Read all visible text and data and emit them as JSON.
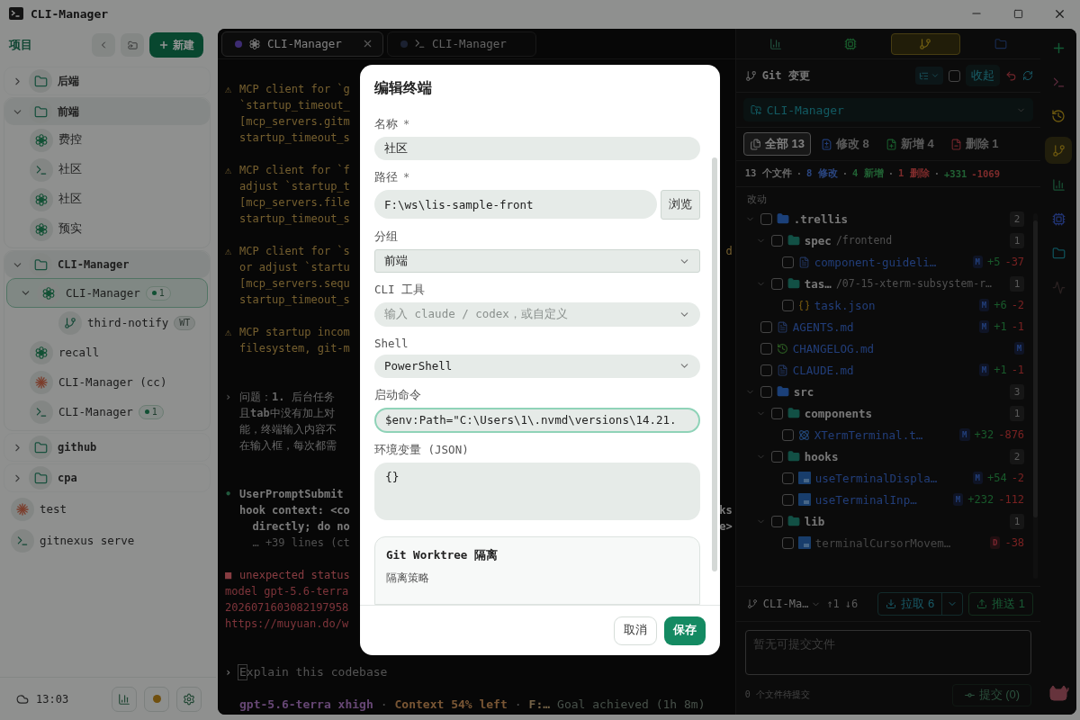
{
  "window": {
    "title": "CLI-Manager"
  },
  "sidebar": {
    "title": "项目",
    "new_button": "新建",
    "clock": "13:03",
    "items": [
      {
        "kind": "group",
        "label": "后端",
        "expanded": false,
        "selected": false
      },
      {
        "kind": "group",
        "label": "前端",
        "expanded": true,
        "selected": false,
        "children": [
          {
            "kind": "codex",
            "label": "费控",
            "selected": false
          },
          {
            "kind": "shell",
            "label": "社区",
            "selected": false
          },
          {
            "kind": "codex",
            "label": "社区",
            "selected": false
          },
          {
            "kind": "codex",
            "label": "预实",
            "selected": false
          }
        ]
      },
      {
        "kind": "group",
        "label": "CLI-Manager",
        "expanded": true,
        "selected": false,
        "children": [
          {
            "kind": "codex",
            "label": "CLI-Manager",
            "selected": true,
            "expanded": true,
            "badge": "1",
            "children": [
              {
                "kind": "worktree",
                "label": "third-notify",
                "selected": false,
                "tag": "WT"
              }
            ]
          },
          {
            "kind": "codex",
            "label": "recall",
            "selected": false
          },
          {
            "kind": "claude",
            "label": "CLI-Manager (cc)",
            "selected": false
          },
          {
            "kind": "shell",
            "label": "CLI-Manager",
            "selected": false,
            "badge": "1"
          }
        ]
      },
      {
        "kind": "group",
        "label": "github",
        "expanded": false,
        "selected": false
      },
      {
        "kind": "group",
        "label": "cpa",
        "expanded": false,
        "selected": false
      },
      {
        "kind": "claude",
        "label": "test",
        "selected": false
      },
      {
        "kind": "shell",
        "label": "gitnexus serve",
        "selected": false
      }
    ]
  },
  "terminal": {
    "tabs": [
      {
        "kind": "codex",
        "label": "CLI-Manager",
        "selected": true,
        "closable": true
      },
      {
        "kind": "shell",
        "label": "CLI-Manager",
        "selected": false,
        "closable": false
      }
    ],
    "blocks": [
      {
        "kind": "warning",
        "marker": "⚠",
        "lines": [
          {
            "text": "MCP client for `g"
          },
          {
            "text": "`startup_timeout_"
          },
          {
            "text": "[mcp_servers.gitm"
          },
          {
            "text": "startup_timeout_s"
          }
        ]
      },
      {
        "kind": "warning",
        "marker": "⚠",
        "lines": [
          {
            "text": "MCP client for `f"
          },
          {
            "text": "adjust `startup_t"
          },
          {
            "text": "[mcp_servers.file"
          },
          {
            "text": "startup_timeout_s"
          }
        ]
      },
      {
        "kind": "warning",
        "marker": "⚠",
        "lines": [
          {
            "text": "MCP client for `s",
            "tail": "d"
          },
          {
            "text": "or adjust `startu"
          },
          {
            "text": "[mcp_servers.sequ"
          },
          {
            "text": "startup_timeout_s"
          }
        ]
      },
      {
        "kind": "warning",
        "marker": "⚠",
        "lines": [
          {
            "text": "MCP startup incom"
          },
          {
            "text": "filesystem, git-m"
          }
        ]
      },
      {
        "kind": "user",
        "marker": "›",
        "lines": [
          {
            "text": "问题：**1.** 后台任务"
          },
          {
            "text": "且**tab**中没有加上对"
          },
          {
            "text": "能，终端输入内容不"
          },
          {
            "text": "在输入框，每次都需"
          }
        ]
      },
      {
        "kind": "hook",
        "marker": "•",
        "lines": [
          {
            "text": "UserPromptSubmit",
            "muted": false
          },
          {
            "text": "hook context: <co",
            "tail": "ks",
            "muted": false
          },
          {
            "text": "  directly; do no",
            "tail": "e>",
            "muted": false
          },
          {
            "text": "  … +39 lines (ct",
            "muted": true
          }
        ]
      },
      {
        "kind": "error",
        "marker": "■",
        "lines": [
          {
            "text": "unexpected status"
          },
          {
            "text": "model gpt-5.6-terra"
          },
          {
            "text": "2026071603082197958"
          },
          {
            "text": "https://muyuan.do/w"
          }
        ]
      }
    ],
    "prompt": {
      "marker": "›",
      "placeholder": "Explain this codebase"
    },
    "status": [
      {
        "kind": "model",
        "text": "gpt-5.6-terra xhigh"
      },
      {
        "kind": "sep",
        "text": "·"
      },
      {
        "kind": "context",
        "text": "Context 54% left"
      },
      {
        "kind": "sep",
        "text": "·"
      },
      {
        "kind": "path",
        "text": "F:…"
      },
      {
        "kind": "goal",
        "text": "Goal achieved (1h 8m)"
      }
    ]
  },
  "git": {
    "tabs": [
      {
        "kind": "stats",
        "selected": false
      },
      {
        "kind": "chip",
        "selected": false
      },
      {
        "kind": "branch",
        "selected": true
      },
      {
        "kind": "folder",
        "selected": false
      }
    ],
    "title": "Git 变更",
    "select_all": false,
    "collapse_button": "收起",
    "repo": "CLI-Manager",
    "filters": [
      {
        "kind": "all",
        "label": "全部",
        "count": "13",
        "selected": true
      },
      {
        "kind": "modified",
        "label": "修改",
        "count": "8",
        "selected": false
      },
      {
        "kind": "added",
        "label": "新增",
        "count": "4",
        "selected": false
      },
      {
        "kind": "deleted",
        "label": "删除",
        "count": "1",
        "selected": false
      }
    ],
    "summary": [
      {
        "kind": "total",
        "text": "13 个文件"
      },
      {
        "kind": "sep",
        "text": "·"
      },
      {
        "kind": "modified",
        "text": "8 修改"
      },
      {
        "kind": "sep",
        "text": "·"
      },
      {
        "kind": "added",
        "text": "4 新增"
      },
      {
        "kind": "sep",
        "text": "·"
      },
      {
        "kind": "deleted",
        "text": "1 删除"
      },
      {
        "kind": "sep",
        "text": "·"
      },
      {
        "kind": "added",
        "text": "+331"
      },
      {
        "kind": "deleted",
        "text": "-1069"
      }
    ],
    "section": "改动",
    "tree": [
      {
        "kind": "folder",
        "name": ".trellis",
        "count": "2",
        "checked": false,
        "expanded": true,
        "children": [
          {
            "kind": "folder",
            "name": "spec",
            "path": "/frontend",
            "count": "1",
            "checked": false,
            "expanded": true,
            "children": [
              {
                "kind": "markdown",
                "name": "component-guideli…",
                "status": "M",
                "deleted": false,
                "added": "+5",
                "removed": "-37",
                "checked": false
              }
            ]
          },
          {
            "kind": "folder",
            "name": "tas…",
            "path": "/07-15-xterm-subsystem-r…",
            "count": "1",
            "checked": false,
            "expanded": true,
            "children": [
              {
                "kind": "json",
                "name": "task.json",
                "status": "M",
                "deleted": false,
                "added": "+6",
                "removed": "-2",
                "checked": false
              }
            ]
          }
        ]
      },
      {
        "kind": "markdown",
        "name": "AGENTS.md",
        "status": "M",
        "deleted": false,
        "added": "+1",
        "removed": "-1",
        "checked": false
      },
      {
        "kind": "changelog",
        "name": "CHANGELOG.md",
        "status": "M",
        "deleted": false,
        "checked": false
      },
      {
        "kind": "markdown",
        "name": "CLAUDE.md",
        "status": "M",
        "deleted": false,
        "added": "+1",
        "removed": "-1",
        "checked": false
      },
      {
        "kind": "folder",
        "name": "src",
        "count": "3",
        "checked": false,
        "expanded": true,
        "children": [
          {
            "kind": "folder",
            "name": "components",
            "count": "1",
            "checked": false,
            "expanded": true,
            "children": [
              {
                "kind": "react",
                "name": "XTermTerminal.t…",
                "status": "M",
                "deleted": false,
                "added": "+32",
                "removed": "-876",
                "checked": false
              }
            ]
          },
          {
            "kind": "folder",
            "name": "hooks",
            "count": "2",
            "checked": false,
            "expanded": true,
            "children": [
              {
                "kind": "typescript",
                "name": "useTerminalDispla…",
                "status": "M",
                "deleted": false,
                "added": "+54",
                "removed": "-2",
                "checked": false
              },
              {
                "kind": "typescript",
                "name": "useTerminalInp…",
                "status": "M",
                "deleted": false,
                "added": "+232",
                "removed": "-112",
                "checked": false
              }
            ]
          },
          {
            "kind": "folder",
            "name": "lib",
            "count": "1",
            "checked": false,
            "expanded": true,
            "children": [
              {
                "kind": "typescript",
                "name": "terminalCursorMovem…",
                "status": "D",
                "deleted": true,
                "removed": "-38",
                "checked": false
              }
            ]
          }
        ]
      }
    ],
    "footer": {
      "branch": "CLI-Ma…",
      "ahead": "↑1",
      "behind": "↓6",
      "pull": "拉取 6",
      "push": "推送 1",
      "commit_placeholder": "暂无可提交文件",
      "pending": "0 个文件待提交",
      "commit": "提交 (0)",
      "commit_disabled": true
    }
  },
  "rail": [
    {
      "kind": "add",
      "selected": false
    },
    {
      "kind": "terminal",
      "selected": false
    },
    {
      "kind": "history",
      "selected": false
    },
    {
      "kind": "branch",
      "selected": true
    },
    {
      "kind": "stats",
      "selected": false
    },
    {
      "kind": "chip",
      "selected": false
    },
    {
      "kind": "folder",
      "selected": false
    },
    {
      "kind": "activity",
      "selected": false
    }
  ],
  "dialog": {
    "title": "编辑终端",
    "fields": [
      {
        "kind": "text",
        "label": "名称",
        "mark": "*",
        "value": "社区",
        "focused": false
      },
      {
        "kind": "path",
        "label": "路径",
        "mark": "*",
        "value": "F:\\ws\\lis-sample-front",
        "button": "浏览",
        "focused": false
      },
      {
        "kind": "dropdown",
        "label": "分组",
        "value": "前端"
      },
      {
        "kind": "select",
        "label": "CLI 工具",
        "placeholder": "输入 claude / codex，或自定义"
      },
      {
        "kind": "select",
        "label": "Shell",
        "value": "PowerShell"
      },
      {
        "kind": "text",
        "label": "启动命令",
        "value": "$env:Path=\"C:\\Users\\1\\.nvmd\\versions\\14.21.",
        "focused": true
      },
      {
        "kind": "textarea",
        "label": "环境变量 (JSON)",
        "value": "{}"
      }
    ],
    "section": {
      "title": "Git Worktree 隔离",
      "label": "隔离策略"
    },
    "buttons": [
      {
        "kind": "secondary",
        "label": "取消"
      },
      {
        "kind": "primary",
        "label": "保存"
      }
    ]
  }
}
